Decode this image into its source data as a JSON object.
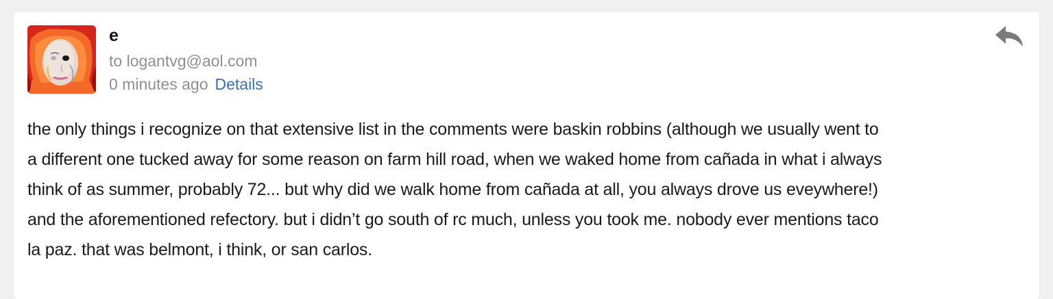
{
  "message": {
    "sender_name": "e",
    "recipient_line": "to logantvg@aol.com",
    "timestamp": "0 minutes ago",
    "details_label": "Details",
    "reply_icon": "reply-icon",
    "avatar_icon": "avatar-portrait",
    "body_lines": [
      "the only things i recognize on that extensive list in the comments were baskin robbins  (although we usually went to",
      "a different one tucked away for some reason on farm hill road, when we waked home from cañada in what i always",
      "think of as summer, probably 72... but why did we walk home from cañada at all, you always drove us eveywhere!)",
      "and the aforementioned refectory.  but i didn’t go south of rc much, unless you took me.  nobody ever mentions taco",
      "la paz. that was belmont, i think, or san carlos."
    ]
  },
  "colors": {
    "page_bg": "#f0f0f0",
    "card_bg": "#ffffff",
    "link": "#3a6fb6",
    "muted": "#8e8e93",
    "text": "#1a1a1a"
  }
}
